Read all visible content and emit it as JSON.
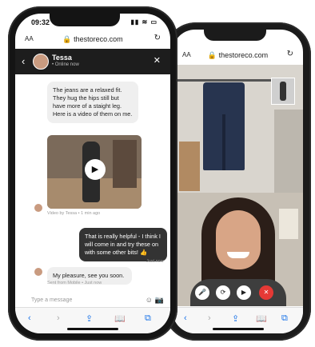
{
  "left_phone": {
    "status": {
      "time": "09:32",
      "signal": "▮▮ ≋ ▭"
    },
    "url_bar": {
      "aa": "AA",
      "url": "🔒 thestoreco.com",
      "reload": "↻"
    },
    "chat": {
      "agent_name": "Tessa",
      "agent_status": "• Online now",
      "messages": [
        {
          "text": "The jeans are a relaxed fit. They hug the hips still but have more of a staight leg. Here is a video of them on me."
        },
        {
          "meta": "Video by Tessa • 1 min ago"
        },
        {
          "text": "That is really helpful - I think I will come in and try these on with some other bits! 👍"
        },
        {
          "meta": "Just now"
        },
        {
          "text": "My pleasure, see you soon."
        },
        {
          "meta": "Sent from Mobile • Just now"
        }
      ],
      "input_placeholder": "Type a message",
      "emoji_icon": "☺",
      "camera_icon": "📷"
    },
    "toolbar": {
      "back": "‹",
      "forward": "›",
      "share": "⇪",
      "bookmarks": "📖",
      "tabs": "⧉"
    }
  },
  "right_phone": {
    "url_bar": {
      "aa": "AA",
      "url": "🔒 thestoreco.com",
      "reload": "↻"
    },
    "call_controls": {
      "mic": "🎤",
      "flip": "⟳",
      "video": "▶",
      "end": "✕"
    },
    "toolbar": {
      "back": "‹",
      "forward": "›",
      "share": "⇪",
      "bookmarks": "📖",
      "tabs": "⧉"
    }
  }
}
